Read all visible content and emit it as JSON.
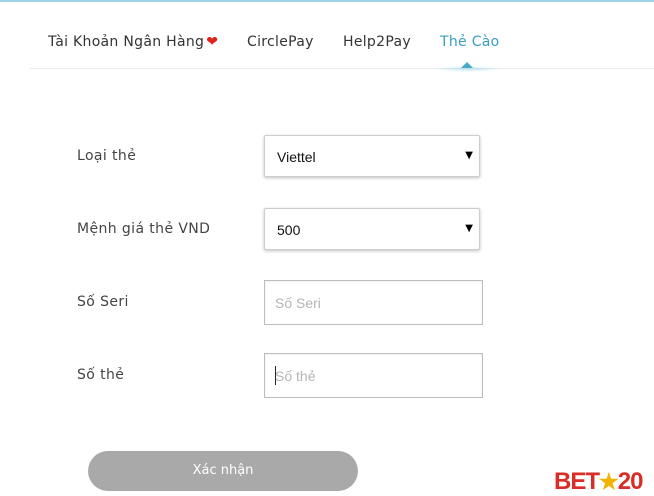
{
  "tabs": [
    {
      "label": "Tài Khoản Ngân Hàng",
      "heart": "❤"
    },
    {
      "label": "CirclePay"
    },
    {
      "label": "Help2Pay"
    },
    {
      "label": "Thẻ Cào"
    }
  ],
  "form": {
    "card_type": {
      "label": "Loại thẻ",
      "value": "Viettel"
    },
    "denomination": {
      "label": "Mệnh giá thẻ VND",
      "value": "500"
    },
    "serial": {
      "label": "Số Seri",
      "placeholder": "Số Seri"
    },
    "card_number": {
      "label": "Số thẻ",
      "placeholder": "Số thẻ"
    }
  },
  "submit_label": "Xác nhận",
  "logo": {
    "left": "BET",
    "star": "★",
    "right": "20"
  },
  "colors": {
    "active_tab": "#3a9fc0",
    "submit_bg": "#a9a9a9",
    "logo_red": "#d92d27",
    "logo_star": "#f2b200"
  }
}
